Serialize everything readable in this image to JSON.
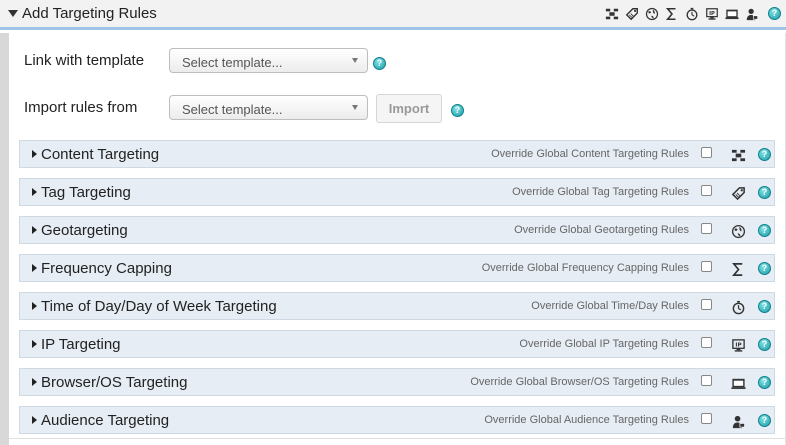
{
  "header": {
    "title": "Add Targeting Rules",
    "icons": [
      "content-icon",
      "tag-icon",
      "globe-icon",
      "sigma-icon",
      "clock-icon",
      "ip-icon",
      "browser-icon",
      "audience-icon"
    ]
  },
  "form": {
    "link_label": "Link with template",
    "link_placeholder": "Select template...",
    "import_label": "Import rules from",
    "import_placeholder": "Select template...",
    "import_button": "Import"
  },
  "sections": [
    {
      "title": "Content Targeting",
      "override": "Override Global Content Targeting Rules",
      "icon": "content-icon"
    },
    {
      "title": "Tag Targeting",
      "override": "Override Global Tag Targeting Rules",
      "icon": "tag-icon"
    },
    {
      "title": "Geotargeting",
      "override": "Override Global Geotargeting Rules",
      "icon": "globe-icon"
    },
    {
      "title": "Frequency Capping",
      "override": "Override Global Frequency Capping Rules",
      "icon": "sigma-icon"
    },
    {
      "title": "Time of Day/Day of Week Targeting",
      "override": "Override Global Time/Day Rules",
      "icon": "clock-icon"
    },
    {
      "title": "IP Targeting",
      "override": "Override Global IP Targeting Rules",
      "icon": "ip-icon"
    },
    {
      "title": "Browser/OS Targeting",
      "override": "Override Global Browser/OS Targeting Rules",
      "icon": "browser-icon"
    },
    {
      "title": "Audience Targeting",
      "override": "Override Global Audience Targeting Rules",
      "icon": "audience-icon"
    }
  ],
  "help_glyph": "?",
  "colors": {
    "accent": "#9ec4e8",
    "section_bg": "#e6edf4",
    "help": "#1a9aa6"
  }
}
